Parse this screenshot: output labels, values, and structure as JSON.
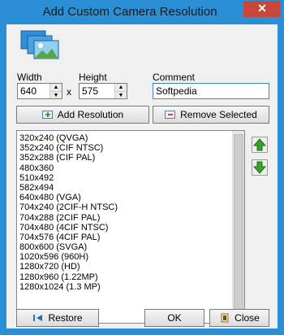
{
  "window": {
    "title": "Add Custom Camera Resolution",
    "close_glyph": "✕"
  },
  "form": {
    "width_label": "Width",
    "width_value": "640",
    "x_label": "x",
    "height_label": "Height",
    "height_value": "575",
    "comment_label": "Comment",
    "comment_value": "Softpedia"
  },
  "buttons": {
    "add": "Add Resolution",
    "remove": "Remove Selected",
    "restore": "Restore",
    "ok": "OK",
    "close": "Close"
  },
  "resolutions": [
    "320x240 (QVGA)",
    "352x240 (CIF NTSC)",
    "352x288 (CIF PAL)",
    "480x360",
    "510x492",
    "582x494",
    "640x480 (VGA)",
    "704x240 (2CIF-H NTSC)",
    "704x288 (2CIF PAL)",
    "704x480 (4CIF NTSC)",
    "704x576 (4CIF PAL)",
    "800x600 (SVGA)",
    "1020x596 (960H)",
    "1280x720 (HD)",
    "1280x960 (1.22MP)",
    "1280x1024 (1.3 MP)"
  ],
  "colors": {
    "accent": "#2b8fd6",
    "close": "#c7483b",
    "move_arrow": "#3aa12a"
  }
}
